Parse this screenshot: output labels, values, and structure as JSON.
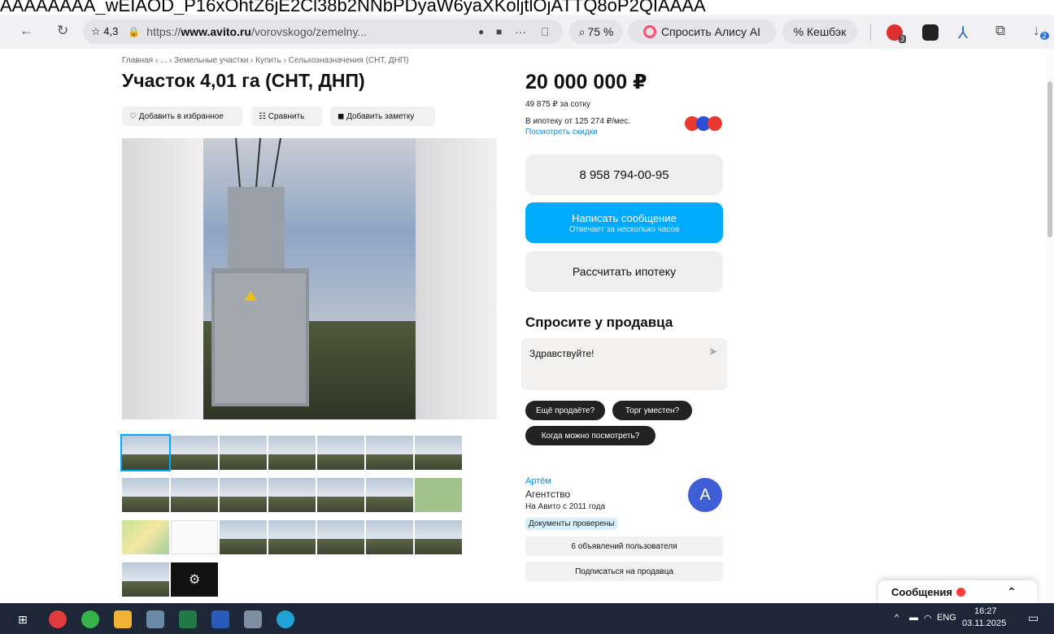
{
  "top_strip_text": "AAAAAAAA_wEIAOD_P16xOhtZ6jE2Cl38b2NNbPDyaW6yaXKoljtlOjATTQ8oP2QIAAAA",
  "browser": {
    "back_glyph": "←",
    "reload_glyph": "↻",
    "rating": "☆ 4,3",
    "lock_glyph": "🔒",
    "url_prefix": "https://",
    "url_domain": "www.avito.ru",
    "url_path": "/vorovskogo/zemelny...",
    "zoom": "75 %",
    "alice_label": "Спросить Алису AI",
    "cashback_label": "% Кешбэк",
    "ext_badge": "3",
    "download_badge": "2"
  },
  "breadcrumb": "Главная › ... › Земельные участки › Купить › Сельхозназначения (СНТ, ДНП)",
  "title": "Участок 4,01 га (СНТ, ДНП)",
  "actions": {
    "favorite": "♡ Добавить в избранное",
    "compare": "☷ Сравнить",
    "note": "◼ Добавить заметку"
  },
  "price": {
    "amount": "20 000 000 ₽",
    "per_sotka": "49 875 ₽ за сотку",
    "mortgage": "В ипотеку от 125 274 ₽/мес.",
    "discounts_link": "Посмотреть скидки"
  },
  "buttons": {
    "phone": "8 958 794-00-95",
    "message": "Написать сообщение",
    "message_sub": "Отвечает за несколько часов",
    "mortgage_calc": "Рассчитать ипотеку"
  },
  "ask": {
    "title": "Спросите у продавца",
    "input_value": "Здравствуйте!",
    "chips": [
      "Ещё продаёте?",
      "Торг уместен?",
      "Когда можно посмотреть?"
    ]
  },
  "seller": {
    "name": "Артём",
    "type": "Агентство",
    "since": "На Авито с 2011 года",
    "badge": "Документы проверены",
    "avatar_letter": "А",
    "listings_btn": "6 объявлений пользователя",
    "subscribe_btn": "Подписаться на продавца"
  },
  "messages_panel": {
    "label": "Сообщения"
  },
  "taskbar": {
    "lang": "ENG",
    "time": "16:27",
    "date": "03.11.2025"
  },
  "colors": {
    "accent_blue": "#00aaff",
    "link_blue": "#0a8ee8",
    "chip_dark": "#222222",
    "taskbar": "#1d2737"
  }
}
